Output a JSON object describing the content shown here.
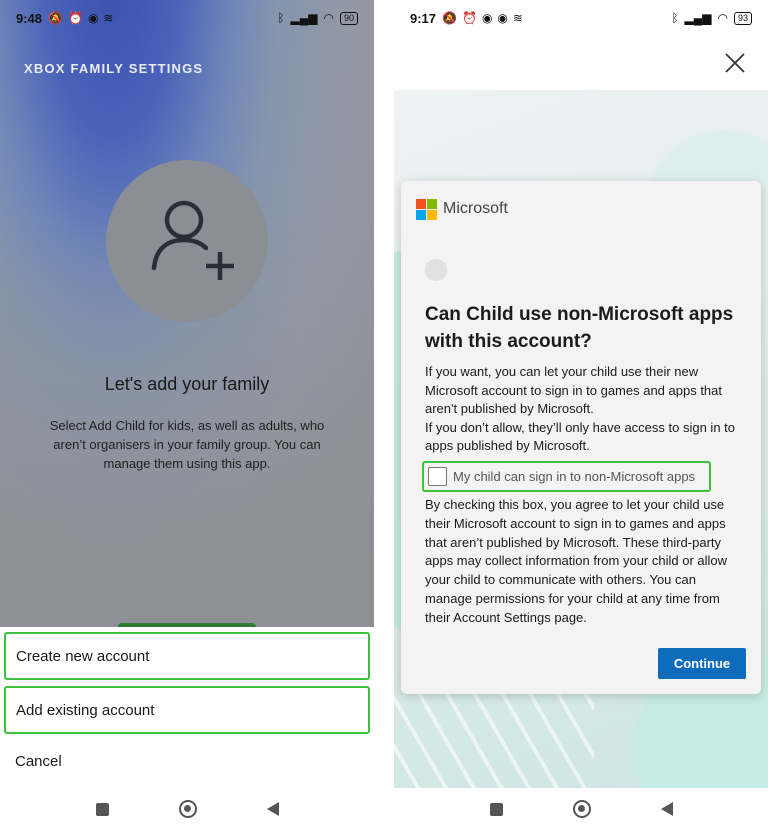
{
  "left_phone": {
    "status": {
      "time": "9:48",
      "battery": "90"
    },
    "header_title": "XBOX FAMILY SETTINGS",
    "heading": "Let's add your family",
    "description": "Select Add Child for kids, as well as adults, who aren’t organisers in your family group. You can manage them using this app.",
    "sheet": {
      "options": [
        "Create new account",
        "Add existing account"
      ],
      "cancel": "Cancel"
    }
  },
  "right_phone": {
    "status": {
      "time": "9:17",
      "battery": "93"
    },
    "dialog": {
      "brand": "Microsoft",
      "title": "Can Child use non-Microsoft apps with this account?",
      "para1_a": "If you want, you can let your child use their new Microsoft account to sign in to games and apps that aren't published by Microsoft.",
      "para1_b": "If you don’t allow, they’ll only have access to sign in to apps published by Microsoft.",
      "checkbox_label": "My child can sign in to non-Microsoft apps",
      "checkbox_checked": false,
      "para2": "By checking this box, you agree to let your child use their Microsoft account to sign in to games and apps that aren’t published by Microsoft. These third-party apps may collect information from your child or allow your child to communicate with others. You can manage permissions for your child at any time from their Account Settings page.",
      "continue_label": "Continue"
    }
  },
  "colors": {
    "highlight": "#3bc23b",
    "primary_button": "#0f6cbd",
    "ms_red": "#f25022",
    "ms_green": "#7fba00",
    "ms_blue": "#00a4ef",
    "ms_yellow": "#ffb900"
  },
  "icons": [
    "add-person-icon",
    "close-icon",
    "microsoft-logo-icon",
    "nav-recents-icon",
    "nav-home-icon",
    "nav-back-icon"
  ]
}
